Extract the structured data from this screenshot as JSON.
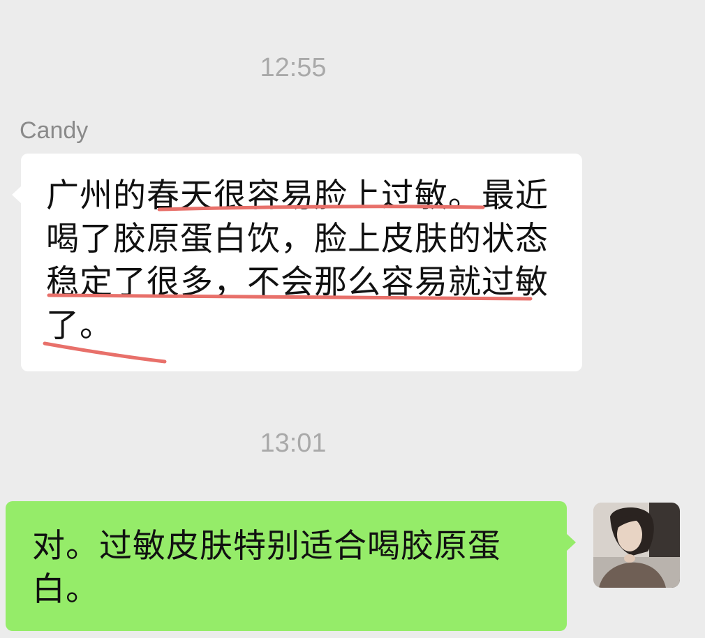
{
  "chat": {
    "messages": [
      {
        "timestamp": "12:55",
        "sender": "Candy",
        "text": "广州的春天很容易脸上过敏。最近喝了胶原蛋白饮，脸上皮肤的状态稳定了很多，不会那么容易就过敏了。",
        "highlight_color": "#e8706a"
      },
      {
        "timestamp": "13:01",
        "text": "对。过敏皮肤特别适合喝胶原蛋白。",
        "bubble_color": "#95ec69"
      }
    ]
  }
}
